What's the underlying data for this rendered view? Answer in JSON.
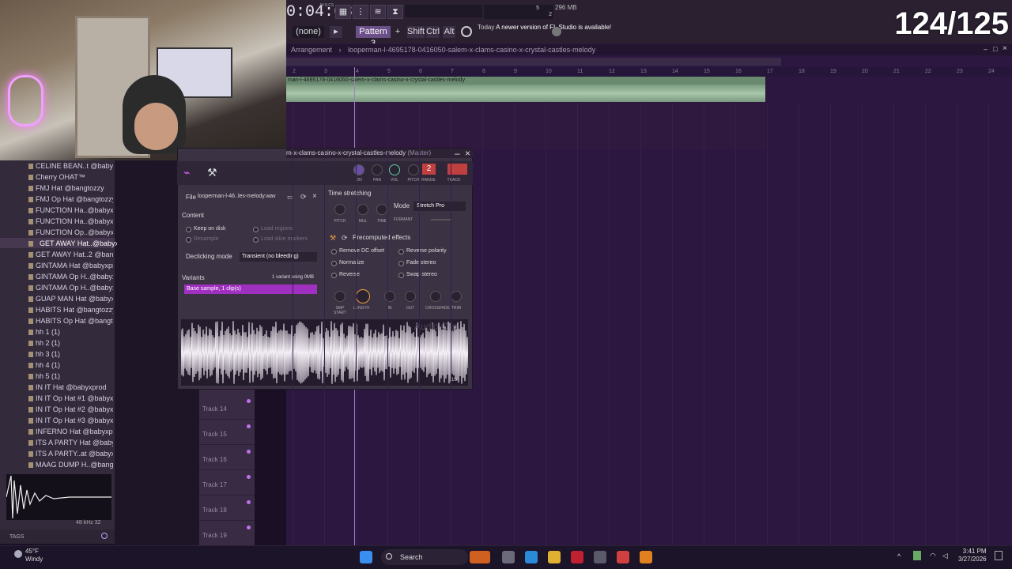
{
  "overlay": {
    "counter": "124/125"
  },
  "toolbar": {
    "time": "0:04:63",
    "time_unit": "M:S:CS",
    "snap_label": "(none)",
    "pattern_label": "Pattern 3",
    "shift_label": "Shift",
    "ctrl_label": "Ctrl",
    "alt_label": "Alt",
    "notice_day": "Today",
    "notice_text": "A newer version of FL Studio is available!",
    "mem_label": "296 MB",
    "cpu_value": "5",
    "poly_value": "2"
  },
  "playlist": {
    "title_prefix": "Arrangement",
    "title": "looperman-l-4695178-0416050-salem-x-clams-casino-x-crystal-castles-melody",
    "clip_name": "man-l-4695178-0416050-salem-x-clams-casino-x-crystal-castles-melody",
    "ruler": [
      "2",
      "3",
      "4",
      "5",
      "6",
      "7",
      "8",
      "9",
      "10",
      "11",
      "12",
      "13",
      "14",
      "15",
      "16",
      "17",
      "18",
      "19",
      "20",
      "21",
      "22",
      "23",
      "24"
    ],
    "tracks": [
      "Track 14",
      "Track 15",
      "Track 16",
      "Track 17",
      "Track 18",
      "Track 19"
    ]
  },
  "browser": {
    "items": [
      "CELINE BEAN..t @babyxprod",
      "Cherry OHAT™",
      "FMJ Hat @bangtozzy",
      "FMJ Op Hat @bangtozzy",
      "FUNCTION Ha..@babyxprod",
      "FUNCTION Ha..@babyxprod",
      "FUNCTION Op..@babyxprod",
      "GET AWAY Hat..@babyxprod",
      "GET AWAY Hat..2 @bangtozzy",
      "GINTAMA Hat @babyxprod",
      "GINTAMA Op H..@babyxprod",
      "GINTAMA Op H..@babyxprod",
      "GUAP MAN Hat @babyxprod",
      "HABITS Hat @bangtozzy",
      "HABITS Op Hat @bangtozzy",
      "hh 1 (1)",
      "hh 2 (1)",
      "hh 3 (1)",
      "hh 4 (1)",
      "hh 5 (1)",
      "IN IT Hat @babyxprod",
      "IN IT Op Hat #1 @babyxprod",
      "IN IT Op Hat #2 @babyxprod",
      "IN IT Op Hat #3 @babyxprod",
      "INFERNO Hat @babyxprod",
      "ITS A PARTY Hat @babyxprod",
      "ITS A PARTY..at @babyxprod",
      "MAAG DUMP H..@bangtozzy"
    ],
    "selected_index": 7,
    "sample_info": "48 kHz 32",
    "tags_label": "TAGS"
  },
  "channel": {
    "title": "m-x-clams-casino-x-crystal-castles-melody",
    "title_suffix": "(Master)",
    "track_number": "2",
    "top_knobs": [
      "ON",
      "PAN",
      "VOL",
      "PITCH",
      "RANGE",
      "TRACK"
    ],
    "file_label": "File",
    "file_name": "looperman-l-46..les-melody.wav",
    "content_label": "Content",
    "keep_on_disk": "Keep on disk",
    "resample": "Resample",
    "load_regions": "Load regions",
    "load_slice_markers": "Load slice markers",
    "declicking_label": "Declicking mode",
    "declicking_value": "Transient (no bleeding)",
    "variants_label": "Variants",
    "variants_info": "1 variant using 0MB",
    "variant_item": "Base sample, 1 clip(s)",
    "time_stretching_label": "Time stretching",
    "stretch_knobs": [
      "PITCH",
      "MUL",
      "TIME"
    ],
    "mode_label": "Mode",
    "mode_value": "Stretch Pro",
    "formant_label": "FORMANT",
    "precomputed_label": "Precomputed effects",
    "effects": [
      "Remove DC offset",
      "Normalize",
      "Reverse",
      "Reverse polarity",
      "Fade stereo",
      "Swap stereo"
    ],
    "bottom_knobs": [
      "SMP START",
      "LENGTH",
      "IN",
      "OUT",
      "CROSSFADE",
      "TRIM"
    ],
    "waveform_label": "Audio Clip",
    "waveform_zoom": "16"
  },
  "taskbar": {
    "temperature": "45°F",
    "condition": "Windy",
    "search_label": "Search",
    "time": "3:41 PM",
    "date": "3/27/2026"
  }
}
